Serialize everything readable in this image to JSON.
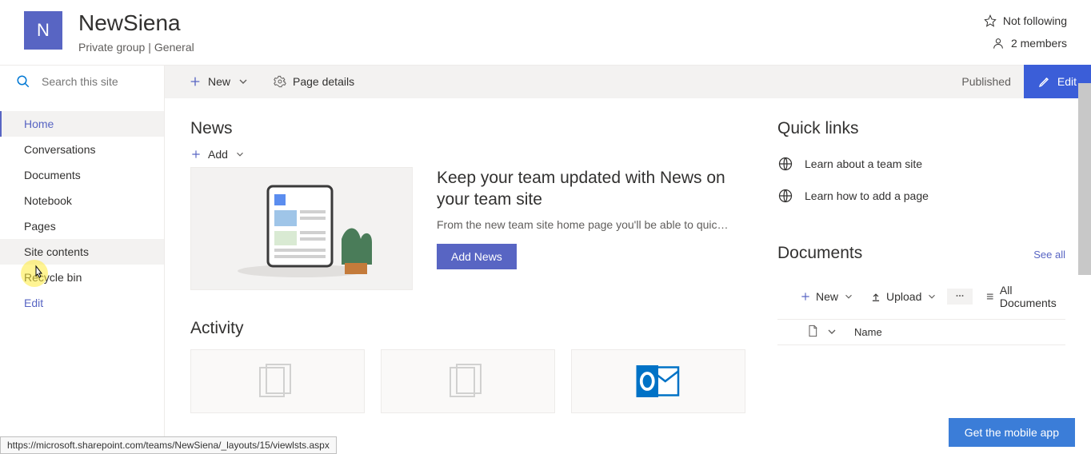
{
  "site": {
    "logo_letter": "N",
    "title": "NewSiena",
    "group_type": "Private group",
    "classification": "General"
  },
  "header_actions": {
    "follow": "Not following",
    "members": "2 members"
  },
  "search": {
    "placeholder": "Search this site"
  },
  "cmdbar": {
    "new": "New",
    "page_details": "Page details",
    "published": "Published",
    "edit": "Edit"
  },
  "nav": {
    "items": [
      "Home",
      "Conversations",
      "Documents",
      "Notebook",
      "Pages",
      "Site contents",
      "Recycle bin"
    ],
    "edit": "Edit"
  },
  "news": {
    "title": "News",
    "add": "Add",
    "heading": "Keep your team updated with News on your team site",
    "body": "From the new team site home page you'll be able to quic…",
    "add_btn": "Add News"
  },
  "activity": {
    "title": "Activity"
  },
  "quicklinks": {
    "title": "Quick links",
    "items": [
      "Learn about a team site",
      "Learn how to add a page"
    ]
  },
  "documents": {
    "title": "Documents",
    "see_all": "See all",
    "new": "New",
    "upload": "Upload",
    "all_docs": "All Documents",
    "col_name": "Name"
  },
  "mobile": {
    "label": "Get the mobile app"
  },
  "status_url": "https://microsoft.sharepoint.com/teams/NewSiena/_layouts/15/viewlsts.aspx"
}
